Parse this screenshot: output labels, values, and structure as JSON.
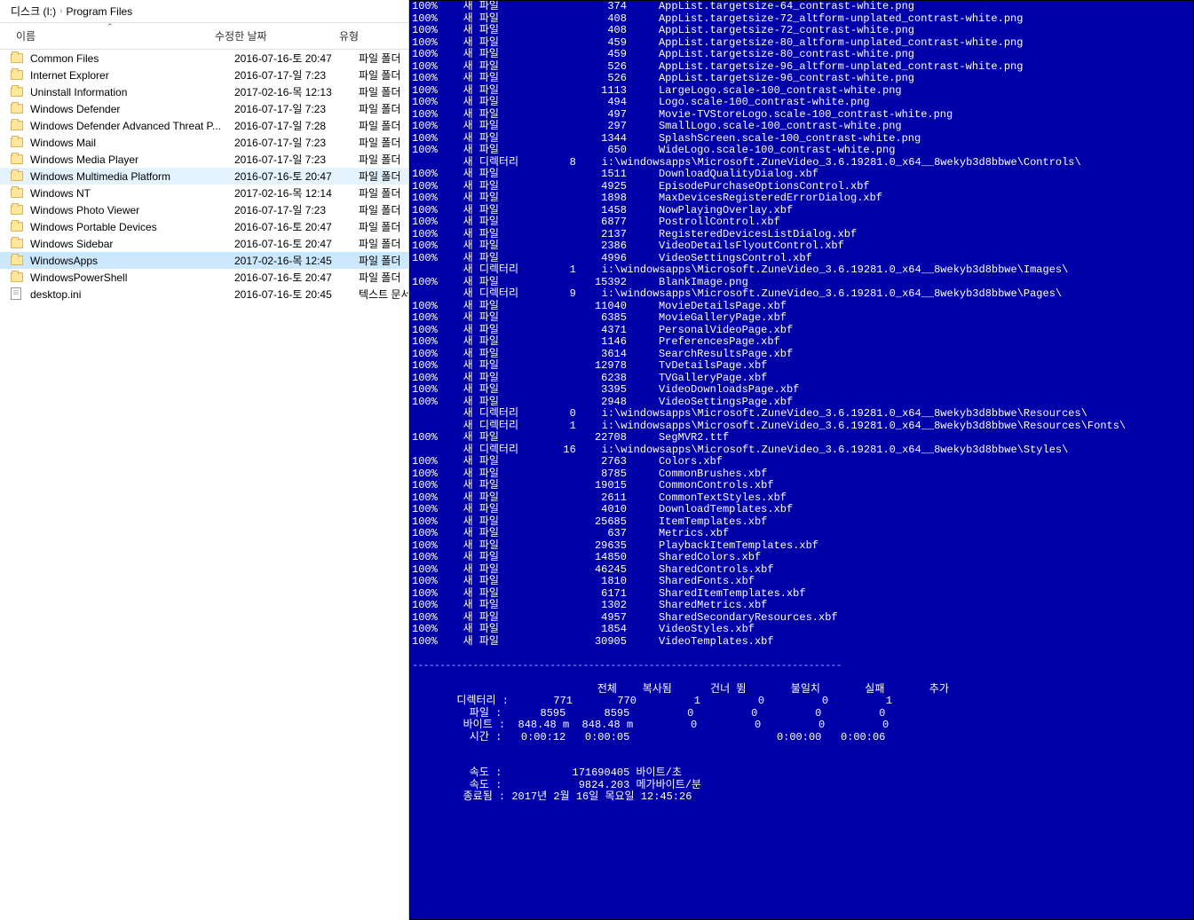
{
  "breadcrumb": {
    "root": "디스크 (I:)",
    "path": "Program Files"
  },
  "headers": {
    "name": "이름",
    "date": "수정한 날짜",
    "type": "유형"
  },
  "type_labels": {
    "folder": "파일 폴더",
    "text": "텍스트 문서"
  },
  "folders": [
    {
      "name": "Common Files",
      "date": "2016-07-16-토 20:47",
      "type": "folder",
      "sel": ""
    },
    {
      "name": "Internet Explorer",
      "date": "2016-07-17-일 7:23",
      "type": "folder",
      "sel": ""
    },
    {
      "name": "Uninstall Information",
      "date": "2017-02-16-목 12:13",
      "type": "folder",
      "sel": ""
    },
    {
      "name": "Windows Defender",
      "date": "2016-07-17-일 7:23",
      "type": "folder",
      "sel": ""
    },
    {
      "name": "Windows Defender Advanced Threat P...",
      "date": "2016-07-17-일 7:28",
      "type": "folder",
      "sel": ""
    },
    {
      "name": "Windows Mail",
      "date": "2016-07-17-일 7:23",
      "type": "folder",
      "sel": ""
    },
    {
      "name": "Windows Media Player",
      "date": "2016-07-17-일 7:23",
      "type": "folder",
      "sel": ""
    },
    {
      "name": "Windows Multimedia Platform",
      "date": "2016-07-16-토 20:47",
      "type": "folder",
      "sel": "hover"
    },
    {
      "name": "Windows NT",
      "date": "2017-02-16-목 12:14",
      "type": "folder",
      "sel": ""
    },
    {
      "name": "Windows Photo Viewer",
      "date": "2016-07-17-일 7:23",
      "type": "folder",
      "sel": ""
    },
    {
      "name": "Windows Portable Devices",
      "date": "2016-07-16-토 20:47",
      "type": "folder",
      "sel": ""
    },
    {
      "name": "Windows Sidebar",
      "date": "2016-07-16-토 20:47",
      "type": "folder",
      "sel": ""
    },
    {
      "name": "WindowsApps",
      "date": "2017-02-16-목 12:45",
      "type": "folder",
      "sel": "selected"
    },
    {
      "name": "WindowsPowerShell",
      "date": "2016-07-16-토 20:47",
      "type": "folder",
      "sel": ""
    },
    {
      "name": "desktop.ini",
      "date": "2016-07-16-토 20:45",
      "type": "text",
      "sel": ""
    }
  ],
  "terminal": {
    "label_newfile": "새 파일",
    "label_newdir": "새 디렉터리",
    "pct": "100%",
    "lines": [
      {
        "t": "f",
        "size": "374",
        "name": "AppList.targetsize-64_contrast-white.png"
      },
      {
        "t": "f",
        "size": "408",
        "name": "AppList.targetsize-72_altform-unplated_contrast-white.png"
      },
      {
        "t": "f",
        "size": "408",
        "name": "AppList.targetsize-72_contrast-white.png"
      },
      {
        "t": "f",
        "size": "459",
        "name": "AppList.targetsize-80_altform-unplated_contrast-white.png"
      },
      {
        "t": "f",
        "size": "459",
        "name": "AppList.targetsize-80_contrast-white.png"
      },
      {
        "t": "f",
        "size": "526",
        "name": "AppList.targetsize-96_altform-unplated_contrast-white.png"
      },
      {
        "t": "f",
        "size": "526",
        "name": "AppList.targetsize-96_contrast-white.png"
      },
      {
        "t": "f",
        "size": "1113",
        "name": "LargeLogo.scale-100_contrast-white.png"
      },
      {
        "t": "f",
        "size": "494",
        "name": "Logo.scale-100_contrast-white.png"
      },
      {
        "t": "f",
        "size": "497",
        "name": "Movie-TVStoreLogo.scale-100_contrast-white.png"
      },
      {
        "t": "f",
        "size": "297",
        "name": "SmallLogo.scale-100_contrast-white.png"
      },
      {
        "t": "f",
        "size": "1344",
        "name": "SplashScreen.scale-100_contrast-white.png"
      },
      {
        "t": "f",
        "size": "650",
        "name": "WideLogo.scale-100_contrast-white.png"
      },
      {
        "t": "d",
        "count": "8",
        "path": "i:\\windowsapps\\Microsoft.ZuneVideo_3.6.19281.0_x64__8wekyb3d8bbwe\\Controls\\"
      },
      {
        "t": "f",
        "size": "1511",
        "name": "DownloadQualityDialog.xbf"
      },
      {
        "t": "f",
        "size": "4925",
        "name": "EpisodePurchaseOptionsControl.xbf"
      },
      {
        "t": "f",
        "size": "1898",
        "name": "MaxDevicesRegisteredErrorDialog.xbf"
      },
      {
        "t": "f",
        "size": "1458",
        "name": "NowPlayingOverlay.xbf"
      },
      {
        "t": "f",
        "size": "6877",
        "name": "PostrollControl.xbf"
      },
      {
        "t": "f",
        "size": "2137",
        "name": "RegisteredDevicesListDialog.xbf"
      },
      {
        "t": "f",
        "size": "2386",
        "name": "VideoDetailsFlyoutControl.xbf"
      },
      {
        "t": "f",
        "size": "4996",
        "name": "VideoSettingsControl.xbf"
      },
      {
        "t": "d",
        "count": "1",
        "path": "i:\\windowsapps\\Microsoft.ZuneVideo_3.6.19281.0_x64__8wekyb3d8bbwe\\Images\\"
      },
      {
        "t": "f",
        "size": "15392",
        "name": "BlankImage.png"
      },
      {
        "t": "d",
        "count": "9",
        "path": "i:\\windowsapps\\Microsoft.ZuneVideo_3.6.19281.0_x64__8wekyb3d8bbwe\\Pages\\"
      },
      {
        "t": "f",
        "size": "11040",
        "name": "MovieDetailsPage.xbf"
      },
      {
        "t": "f",
        "size": "6385",
        "name": "MovieGalleryPage.xbf"
      },
      {
        "t": "f",
        "size": "4371",
        "name": "PersonalVideoPage.xbf"
      },
      {
        "t": "f",
        "size": "1146",
        "name": "PreferencesPage.xbf"
      },
      {
        "t": "f",
        "size": "3614",
        "name": "SearchResultsPage.xbf"
      },
      {
        "t": "f",
        "size": "12978",
        "name": "TvDetailsPage.xbf"
      },
      {
        "t": "f",
        "size": "6238",
        "name": "TVGalleryPage.xbf"
      },
      {
        "t": "f",
        "size": "3395",
        "name": "VideoDownloadsPage.xbf"
      },
      {
        "t": "f",
        "size": "2948",
        "name": "VideoSettingsPage.xbf"
      },
      {
        "t": "d",
        "count": "0",
        "path": "i:\\windowsapps\\Microsoft.ZuneVideo_3.6.19281.0_x64__8wekyb3d8bbwe\\Resources\\"
      },
      {
        "t": "d",
        "count": "1",
        "path": "i:\\windowsapps\\Microsoft.ZuneVideo_3.6.19281.0_x64__8wekyb3d8bbwe\\Resources\\Fonts\\"
      },
      {
        "t": "f",
        "size": "22708",
        "name": "SegMVR2.ttf"
      },
      {
        "t": "d",
        "count": "16",
        "path": "i:\\windowsapps\\Microsoft.ZuneVideo_3.6.19281.0_x64__8wekyb3d8bbwe\\Styles\\"
      },
      {
        "t": "f",
        "size": "2763",
        "name": "Colors.xbf"
      },
      {
        "t": "f",
        "size": "8785",
        "name": "CommonBrushes.xbf"
      },
      {
        "t": "f",
        "size": "19015",
        "name": "CommonControls.xbf"
      },
      {
        "t": "f",
        "size": "2611",
        "name": "CommonTextStyles.xbf"
      },
      {
        "t": "f",
        "size": "4010",
        "name": "DownloadTemplates.xbf"
      },
      {
        "t": "f",
        "size": "25685",
        "name": "ItemTemplates.xbf"
      },
      {
        "t": "f",
        "size": "637",
        "name": "Metrics.xbf"
      },
      {
        "t": "f",
        "size": "29635",
        "name": "PlaybackItemTemplates.xbf"
      },
      {
        "t": "f",
        "size": "14850",
        "name": "SharedColors.xbf"
      },
      {
        "t": "f",
        "size": "46245",
        "name": "SharedControls.xbf"
      },
      {
        "t": "f",
        "size": "1810",
        "name": "SharedFonts.xbf"
      },
      {
        "t": "f",
        "size": "6171",
        "name": "SharedItemTemplates.xbf"
      },
      {
        "t": "f",
        "size": "1302",
        "name": "SharedMetrics.xbf"
      },
      {
        "t": "f",
        "size": "4957",
        "name": "SharedSecondaryResources.xbf"
      },
      {
        "t": "f",
        "size": "1854",
        "name": "VideoStyles.xbf"
      },
      {
        "t": "f",
        "size": "30905",
        "name": "VideoTemplates.xbf"
      }
    ],
    "summary": {
      "separator": "------------------------------------------------------------------------------",
      "header_row": "                전체    복사됨      건너 뜀       불일치       실패       추가",
      "dirs_label": "디렉터리 :",
      "dirs": "       771       770         1         0         0         1",
      "files_label": "파일 :",
      "files": "      8595      8595         0         0         0         0",
      "bytes_label": "바이트 :",
      "bytes": "  848.48 m  848.48 m         0         0         0         0",
      "time_label": "시간 :",
      "time": "   0:00:12   0:00:05                       0:00:00   0:00:06",
      "speed1_label": "속도 :",
      "speed1": "           171690405 바이트/초",
      "speed2_label": "속도 :",
      "speed2": "            9824.203 메가바이트/분",
      "end_label": "종료됨 :",
      "end": " 2017년 2월 16일 목요일 12:45:26"
    }
  }
}
